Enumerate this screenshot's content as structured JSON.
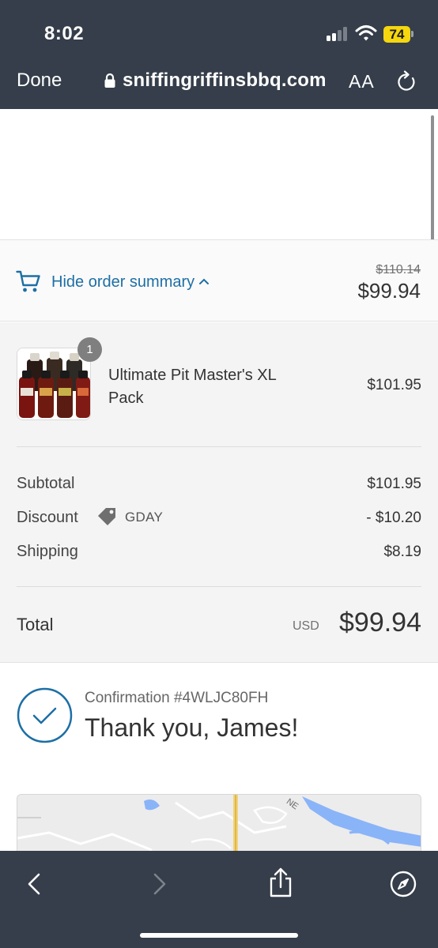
{
  "status_bar": {
    "time": "8:02",
    "battery": "74",
    "colors": {
      "battery": "#f5d60f",
      "chrome_bg": "#353e4a"
    }
  },
  "browser": {
    "done_label": "Done",
    "url": "sniffingriffinsbbq.com",
    "text_size_label": "AA",
    "icons": [
      "lock-icon",
      "reload-icon",
      "back-icon",
      "forward-icon",
      "share-icon",
      "compass-icon"
    ]
  },
  "order_toggle": {
    "label": "Hide order summary",
    "original_price": "$110.14",
    "price": "$99.94",
    "icons": [
      "cart-icon",
      "chevron-up-icon"
    ],
    "accent_color": "#1d6fa5"
  },
  "line_item": {
    "quantity": "1",
    "name": "Ultimate Pit Master's XL Pack",
    "price": "$101.95"
  },
  "totals": {
    "subtotal_label": "Subtotal",
    "subtotal": "$101.95",
    "discount_label": "Discount",
    "discount_code": "GDAY",
    "discount": "- $10.20",
    "shipping_label": "Shipping",
    "shipping": "$8.19",
    "total_label": "Total",
    "currency": "USD",
    "total": "$99.94"
  },
  "confirmation": {
    "number": "Confirmation #4WLJC80FH",
    "thanks": "Thank you, James!"
  },
  "map": {
    "street_label": "NE"
  }
}
